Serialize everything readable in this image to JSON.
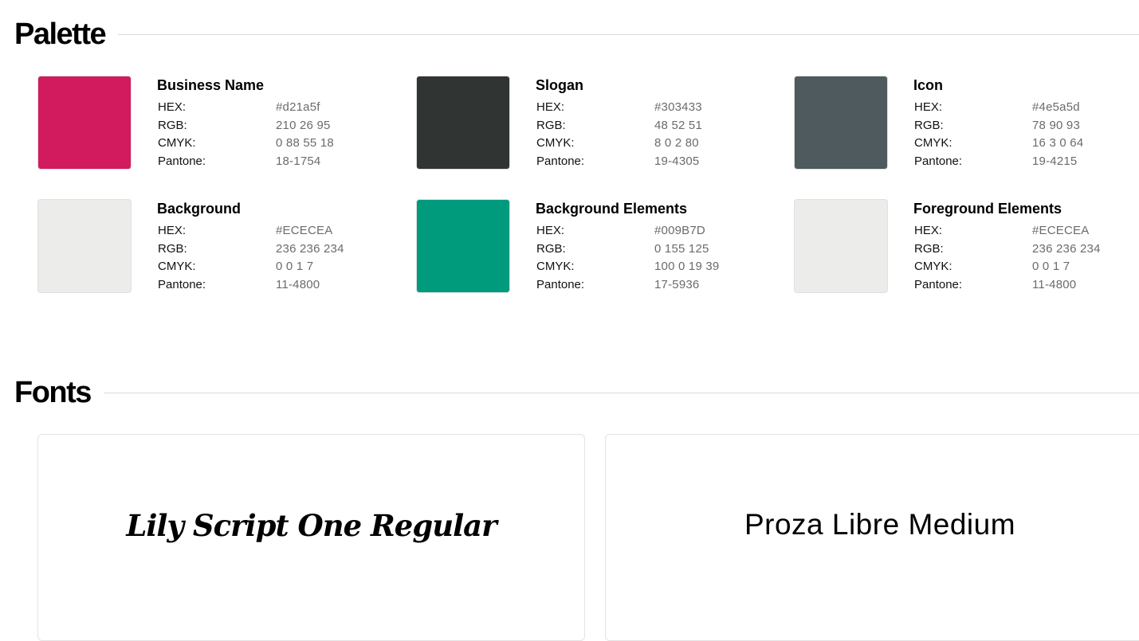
{
  "palette": {
    "title": "Palette",
    "swatches": [
      {
        "name": "Business Name",
        "color": "#d21a5f",
        "hex": "#d21a5f",
        "rgb": "210 26 95",
        "cmyk": "0 88 55 18",
        "pantone": "18-1754"
      },
      {
        "name": "Slogan",
        "color": "#303433",
        "hex": "#303433",
        "rgb": "48 52 51",
        "cmyk": "8 0 2 80",
        "pantone": "19-4305"
      },
      {
        "name": "Icon",
        "color": "#4e5a5d",
        "hex": "#4e5a5d",
        "rgb": "78 90 93",
        "cmyk": "16 3 0 64",
        "pantone": "19-4215"
      },
      {
        "name": "Background",
        "color": "#ECECEA",
        "hex": "#ECECEA",
        "rgb": "236 236 234",
        "cmyk": "0 0 1 7",
        "pantone": "11-4800"
      },
      {
        "name": "Background Elements",
        "color": "#009B7D",
        "hex": "#009B7D",
        "rgb": "0 155 125",
        "cmyk": "100 0 19 39",
        "pantone": "17-5936"
      },
      {
        "name": "Foreground Elements",
        "color": "#ECECEA",
        "hex": "#ECECEA",
        "rgb": "236 236 234",
        "cmyk": "0 0 1 7",
        "pantone": "11-4800"
      }
    ],
    "labels": {
      "hex": "HEX:",
      "rgb": "RGB:",
      "cmyk": "CMYK:",
      "pantone": "Pantone:"
    }
  },
  "fonts": {
    "title": "Fonts",
    "samples": [
      {
        "label": "Lily Script One Regular"
      },
      {
        "label": "Proza Libre Medium"
      }
    ]
  }
}
